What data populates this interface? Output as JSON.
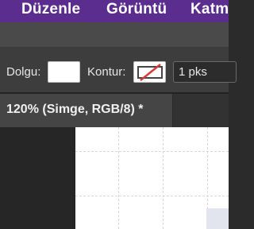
{
  "menubar": {
    "items": [
      {
        "label": "Düzenle"
      },
      {
        "label": "Görüntü"
      },
      {
        "label": "Katm"
      }
    ]
  },
  "options": {
    "fill_label": "Dolgu:",
    "stroke_label": "Kontur:",
    "stroke_width_value": "1 pks"
  },
  "document": {
    "tab_title": "120% (Simge, RGB/8) *"
  },
  "colors": {
    "menubar_bg": "#5b2d8e",
    "fill_swatch": "#ffffff",
    "stroke_none_slash": "#d33a3a"
  }
}
